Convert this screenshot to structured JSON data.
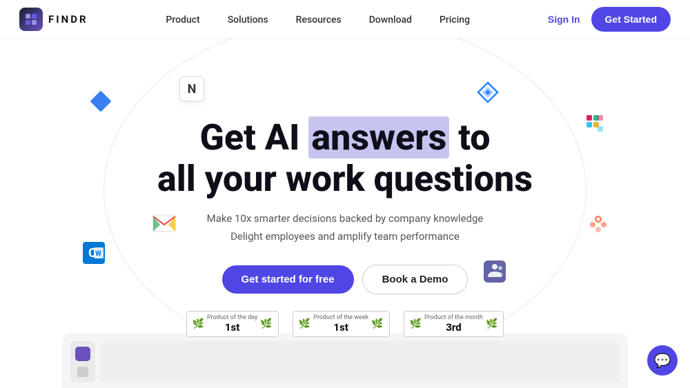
{
  "nav": {
    "logo_text": "FINDR",
    "links": [
      {
        "label": "Product",
        "id": "product"
      },
      {
        "label": "Solutions",
        "id": "solutions"
      },
      {
        "label": "Resources",
        "id": "resources"
      },
      {
        "label": "Download",
        "id": "download"
      },
      {
        "label": "Pricing",
        "id": "pricing"
      }
    ],
    "sign_in_label": "Sign In",
    "get_started_label": "Get Started"
  },
  "hero": {
    "title_part1": "Get AI ",
    "title_highlight": "answers",
    "title_part2": " to",
    "title_line2": "all your work questions",
    "subtitle_line1": "Make 10x smarter decisions backed by company knowledge",
    "subtitle_line2": "Delight employees and amplify team performance",
    "cta_primary": "Get started for free",
    "cta_secondary": "Book a Demo",
    "badges": [
      {
        "label": "Product of the day",
        "rank": "1st"
      },
      {
        "label": "Product of the week",
        "rank": "1st"
      },
      {
        "label": "Product of the month",
        "rank": "3rd"
      }
    ]
  },
  "chat": {
    "icon": "💬"
  },
  "icons": {
    "notion": "N",
    "diamond_color": "#3b7ff5",
    "jira_color": "#2684FF",
    "slack_colors": [
      "#E01E5A",
      "#36C5F0",
      "#2EB67D",
      "#ECB22E"
    ],
    "gmail_color": "#EA4335",
    "outlook_color": "#0078D4",
    "hubspot_color": "#FF7A59",
    "teams_color": "#6264A7"
  }
}
